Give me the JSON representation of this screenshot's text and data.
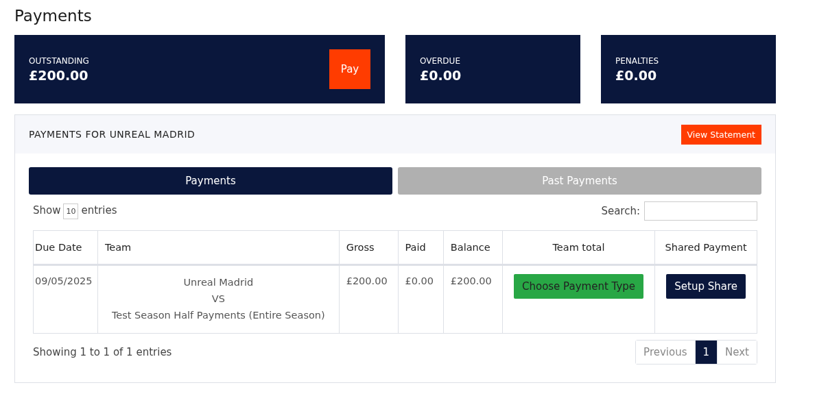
{
  "title": "Payments",
  "summary_cards": [
    {
      "label": "OUTSTANDING",
      "amount": "£200.00",
      "button": "Pay"
    },
    {
      "label": "OVERDUE",
      "amount": "£0.00"
    },
    {
      "label": "PENALTIES",
      "amount": "£0.00"
    }
  ],
  "panel": {
    "title": "PAYMENTS FOR UNREAL MADRID",
    "button": "View Statement",
    "tabs": [
      {
        "label": "Payments",
        "selected": true
      },
      {
        "label": "Past Payments",
        "selected": false
      }
    ],
    "length_control": {
      "prefix": "Show",
      "value": "10",
      "suffix": "entries"
    },
    "search": {
      "label": "Search:"
    },
    "table": {
      "columns": [
        "Due Date",
        "Team",
        "Gross",
        "Paid",
        "Balance",
        "Team total",
        "Shared Payment"
      ],
      "rows": [
        [
          {
            "kind": "text",
            "lines": [
              "09/05/2025"
            ]
          },
          {
            "kind": "center",
            "lines": [
              "Unreal Madrid",
              "VS",
              "Test Season Half Payments (Entire Season)"
            ]
          },
          {
            "kind": "text",
            "lines": [
              "£200.00"
            ]
          },
          {
            "kind": "text",
            "lines": [
              "£0.00"
            ]
          },
          {
            "kind": "text",
            "lines": [
              "£200.00"
            ]
          },
          {
            "kind": "green-button",
            "lines": [
              "Choose Payment Type"
            ]
          },
          {
            "kind": "dark-button",
            "lines": [
              "Setup Share"
            ]
          }
        ]
      ]
    },
    "info": "Showing 1 to 1 of 1 entries",
    "pagination": [
      {
        "label": "Previous",
        "selected": false
      },
      {
        "label": "1",
        "selected": true
      },
      {
        "label": "Next",
        "selected": false
      }
    ]
  }
}
